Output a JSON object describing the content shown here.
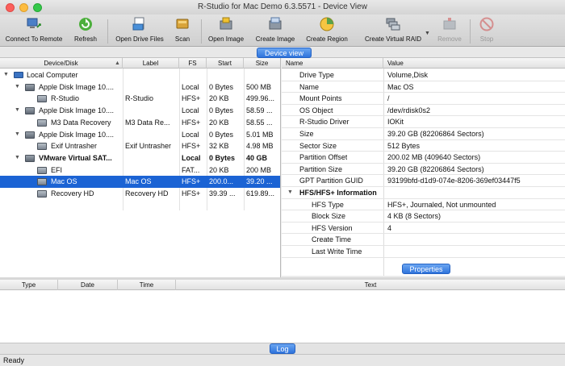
{
  "window": {
    "title": "R-Studio for Mac Demo 6.3.5571 - Device View"
  },
  "toolbar": {
    "connect": "Connect To Remote",
    "refresh": "Refresh",
    "open_drive_files": "Open Drive Files",
    "scan": "Scan",
    "open_image": "Open Image",
    "create_image": "Create Image",
    "create_region": "Create Region",
    "create_virtual_raid": "Create Virtual RAID",
    "remove": "Remove",
    "stop": "Stop"
  },
  "device_view_tab": "Device view",
  "properties_tab": "Properties",
  "log_tab": "Log",
  "left_table": {
    "columns": [
      "Device/Disk",
      "Label",
      "FS",
      "Start",
      "Size"
    ],
    "sort_indicator": "▲",
    "rows": [
      {
        "name": "Local Computer",
        "label": "",
        "fs": "",
        "start": "",
        "size": ""
      },
      {
        "name": "Apple Disk Image 10....",
        "label": "",
        "fs": "Local",
        "start": "0 Bytes",
        "size": "500 MB"
      },
      {
        "name": "R-Studio",
        "label": "R-Studio",
        "fs": "HFS+",
        "start": "20 KB",
        "size": "499.96..."
      },
      {
        "name": "Apple Disk Image 10....",
        "label": "",
        "fs": "Local",
        "start": "0 Bytes",
        "size": "58.59 ..."
      },
      {
        "name": "M3 Data Recovery",
        "label": "M3 Data Re...",
        "fs": "HFS+",
        "start": "20 KB",
        "size": "58.55 ..."
      },
      {
        "name": "Apple Disk Image 10....",
        "label": "",
        "fs": "Local",
        "start": "0 Bytes",
        "size": "5.01 MB"
      },
      {
        "name": "Exif Untrasher",
        "label": "Exif Untrasher",
        "fs": "HFS+",
        "start": "32 KB",
        "size": "4.98 MB"
      },
      {
        "name": "VMware Virtual SAT...",
        "label": "",
        "fs": "Local",
        "start": "0 Bytes",
        "size": "40 GB"
      },
      {
        "name": "EFI",
        "label": "",
        "fs": "FAT...",
        "start": "20 KB",
        "size": "200 MB"
      },
      {
        "name": "Mac OS",
        "label": "Mac OS",
        "fs": "HFS+",
        "start": "200.0...",
        "size": "39.20 ..."
      },
      {
        "name": "Recovery HD",
        "label": "Recovery HD",
        "fs": "HFS+",
        "start": "39.39 ...",
        "size": "619.89..."
      }
    ]
  },
  "properties": {
    "columns": [
      "Name",
      "Value"
    ],
    "rows": [
      {
        "name": "Drive Type",
        "value": "Volume,Disk"
      },
      {
        "name": "Name",
        "value": "Mac OS"
      },
      {
        "name": "Mount Points",
        "value": "/"
      },
      {
        "name": "OS Object",
        "value": "/dev/rdisk0s2"
      },
      {
        "name": "R-Studio Driver",
        "value": "IOKit"
      },
      {
        "name": "Size",
        "value": "39.20 GB (82206864 Sectors)"
      },
      {
        "name": "Sector Size",
        "value": "512 Bytes"
      },
      {
        "name": "Partition Offset",
        "value": "200.02 MB (409640 Sectors)"
      },
      {
        "name": "Partition Size",
        "value": "39.20 GB (82206864 Sectors)"
      },
      {
        "name": "GPT Partition GUID",
        "value": "93199bfd-d1d9-074e-8206-369ef03447f5"
      },
      {
        "name": "HFS/HFS+ Information",
        "value": ""
      },
      {
        "name": "HFS Type",
        "value": "HFS+, Journaled, Not unmounted"
      },
      {
        "name": "Block Size",
        "value": "4 KB (8 Sectors)"
      },
      {
        "name": "HFS Version",
        "value": "4"
      },
      {
        "name": "Create Time",
        "value": ""
      },
      {
        "name": "Last Write Time",
        "value": ""
      }
    ]
  },
  "log": {
    "columns": [
      "Type",
      "Date",
      "Time",
      "Text"
    ]
  },
  "status": {
    "text": "Ready"
  }
}
